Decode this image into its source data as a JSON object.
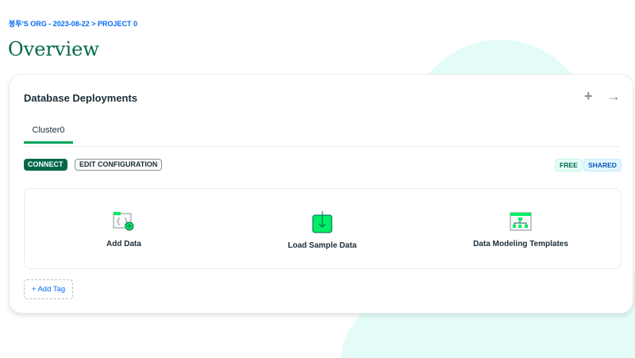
{
  "breadcrumb": "봉투'S ORG - 2023-08-22 > PROJECT 0",
  "page_title": "Overview",
  "card": {
    "title": "Database Deployments",
    "tab": "Cluster0",
    "connect": "CONNECT",
    "edit": "EDIT CONFIGURATION",
    "badges": [
      "FREE",
      "SHARED"
    ],
    "actions": [
      {
        "label": "Add Data"
      },
      {
        "label": "Load Sample Data"
      },
      {
        "label": "Data Modeling Templates"
      }
    ],
    "add_tag": "+ Add Tag",
    "add_icon": "+",
    "arrow_icon": "→"
  }
}
